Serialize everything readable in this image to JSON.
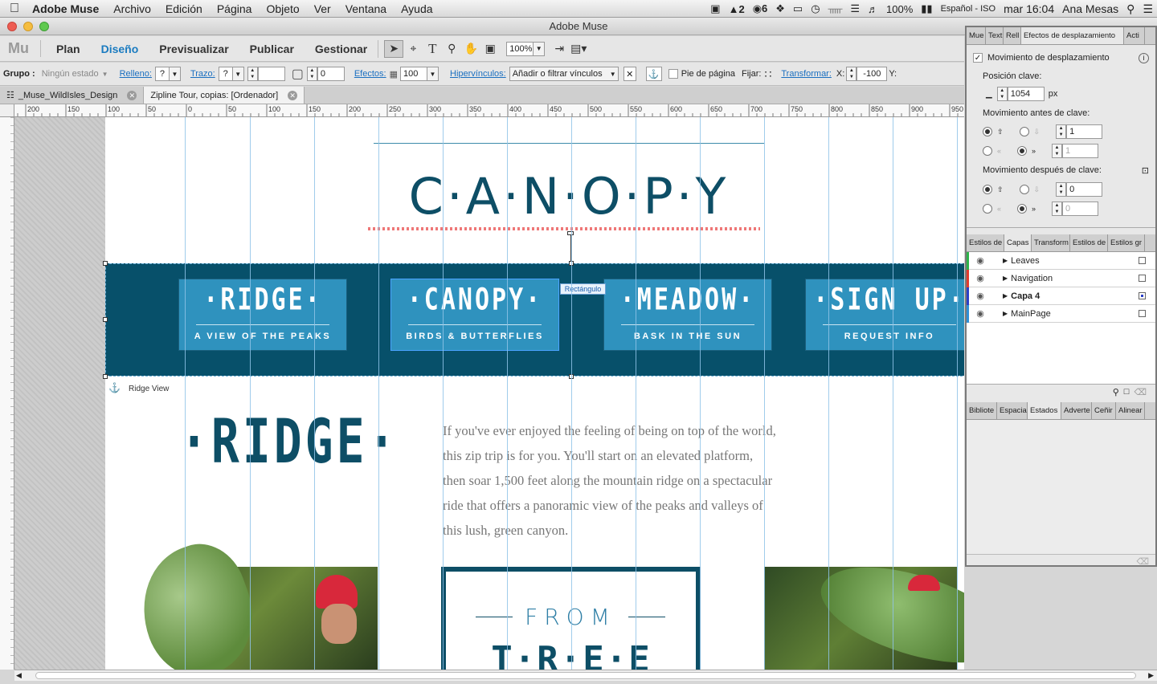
{
  "menubar": {
    "app_name": "Adobe Muse",
    "items": [
      "Archivo",
      "Edición",
      "Página",
      "Objeto",
      "Ver",
      "Ventana",
      "Ayuda"
    ],
    "status": {
      "notif_a": "2",
      "notif_b": "6",
      "battery": "100%",
      "input_lang": "Español - ISO",
      "clock": "mar 16:04",
      "user": "Ana Mesas"
    }
  },
  "window": {
    "title": "Adobe Muse"
  },
  "toolbar": {
    "logo": "Mu",
    "modes": [
      "Plan",
      "Diseño",
      "Previsualizar",
      "Publicar",
      "Gestionar"
    ],
    "active_mode": "Diseño",
    "zoom": "100%"
  },
  "controlbar": {
    "group_label": "Grupo :",
    "state": "Ningún estado",
    "fill_label": "Relleno:",
    "fill_value": "?",
    "stroke_label": "Trazo:",
    "stroke_value": "?",
    "corner_value": "0",
    "effects_label": "Efectos:",
    "effects_value": "100",
    "hyperlinks_label": "Hipervínculos:",
    "hyperlinks_placeholder": "Añadir o filtrar vínculos",
    "footer_label": "Pie de página",
    "pin_label": "Fijar:",
    "transform_label": "Transformar:",
    "x_label": "X:",
    "x_value": "-100",
    "y_label": "Y:"
  },
  "doctabs": [
    {
      "label": "_Muse_WildIsles_Design",
      "active": false
    },
    {
      "label": "Zipline Tour, copias: [Ordenador]",
      "active": true
    }
  ],
  "ruler": {
    "h_ticks": [
      "200",
      "150",
      "100",
      "50",
      "0",
      "50",
      "100",
      "150",
      "200",
      "250",
      "300",
      "350",
      "400",
      "450",
      "500",
      "550",
      "600",
      "650",
      "700",
      "750",
      "800",
      "850",
      "900",
      "950"
    ]
  },
  "page": {
    "brand": "C·A·N·O·P·Y",
    "nav": [
      {
        "title": "·RIDGE·",
        "subtitle": "A VIEW OF THE PEAKS"
      },
      {
        "title": "·CANOPY·",
        "subtitle": "BIRDS & BUTTERFLIES"
      },
      {
        "title": "·MEADOW·",
        "subtitle": "BASK IN THE SUN"
      },
      {
        "title": "·SIGN UP·",
        "subtitle": "REQUEST INFO"
      }
    ],
    "selection_tag": "Rectángulo",
    "anchor_label": "Ridge View",
    "section_title": "·RIDGE·",
    "body_lines": [
      "If you've ever enjoyed the feeling of being on top of the world,",
      "this zip trip is for you. You'll start on an elevated platform,",
      "then soar 1,500 feet along the mountain ridge on a spectacular",
      "ride that offers a panoramic view of the peaks and valleys of",
      "this lush, green canyon."
    ],
    "from_text": "FROM",
    "tree_text": "T·R·E·E"
  },
  "scroll_panel": {
    "tabs": [
      "Mue",
      "Text",
      "Rell",
      "Efectos de desplazamiento",
      "Acti"
    ],
    "motion_label": "Movimiento de desplazamiento",
    "key_position_label": "Posición clave:",
    "key_position_value": "1054",
    "unit": "px",
    "before_label": "Movimiento antes de clave:",
    "before_value_1": "1",
    "before_value_2": "1",
    "after_label": "Movimiento después de clave:",
    "after_value_1": "0",
    "after_value_2": "0"
  },
  "layers_panel": {
    "tabs": [
      "Estilos de",
      "Capas",
      "Transform",
      "Estilos de",
      "Estilos gr"
    ],
    "layers": [
      {
        "name": "Leaves",
        "color": "#2db34a"
      },
      {
        "name": "Navigation",
        "color": "#e23b2e"
      },
      {
        "name": "Capa 4",
        "color": "#2a3fc7"
      },
      {
        "name": "MainPage",
        "color": "#2f8fd6"
      }
    ]
  },
  "bottom_panel": {
    "tabs": [
      "Bibliote",
      "Espacia",
      "Estados",
      "Adverte",
      "Ceñir",
      "Alinear"
    ]
  },
  "colors": {
    "brand_dark": "#07506a",
    "button_blue": "#2f92be",
    "accent_link": "#1a6fc0"
  }
}
